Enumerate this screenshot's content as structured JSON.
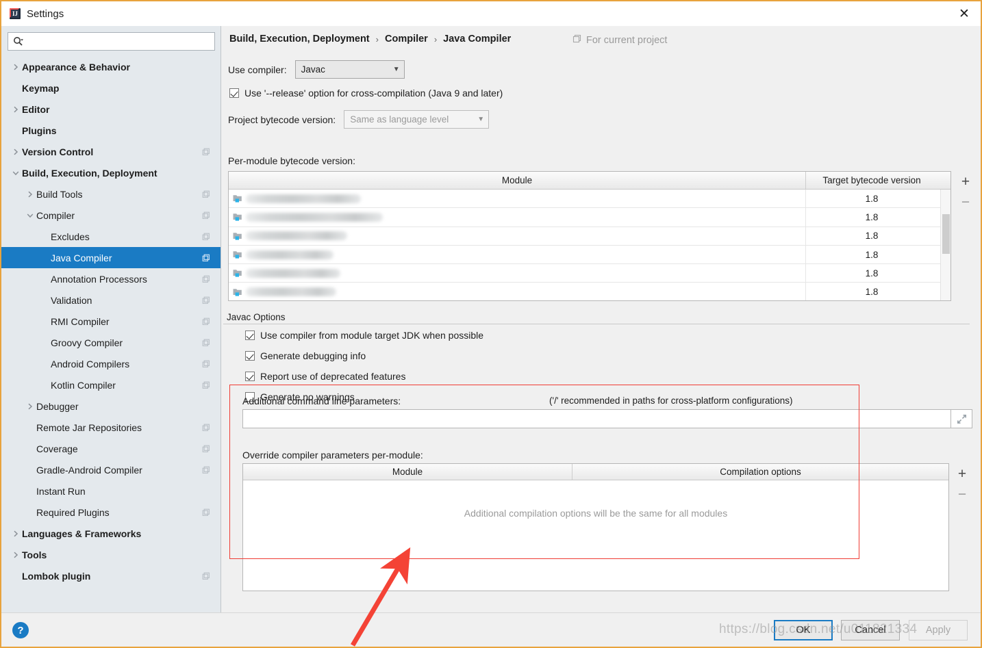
{
  "window": {
    "title": "Settings",
    "app_icon": "intellij-idea-icon",
    "close_label": "✕",
    "accent_color": "#1a7bc4",
    "border_color": "#e8a33d"
  },
  "sidebar": {
    "search": {
      "placeholder": "",
      "value": "",
      "icon": "search-icon"
    },
    "items": [
      {
        "label": "Appearance & Behavior",
        "indent": 0,
        "arrow": "right",
        "bold": true,
        "copy": false,
        "selected": false
      },
      {
        "label": "Keymap",
        "indent": 0,
        "arrow": "none",
        "bold": true,
        "copy": false,
        "selected": false
      },
      {
        "label": "Editor",
        "indent": 0,
        "arrow": "right",
        "bold": true,
        "copy": false,
        "selected": false
      },
      {
        "label": "Plugins",
        "indent": 0,
        "arrow": "none",
        "bold": true,
        "copy": false,
        "selected": false
      },
      {
        "label": "Version Control",
        "indent": 0,
        "arrow": "right",
        "bold": true,
        "copy": true,
        "selected": false
      },
      {
        "label": "Build, Execution, Deployment",
        "indent": 0,
        "arrow": "down",
        "bold": true,
        "copy": false,
        "selected": false
      },
      {
        "label": "Build Tools",
        "indent": 1,
        "arrow": "right",
        "bold": false,
        "copy": true,
        "selected": false
      },
      {
        "label": "Compiler",
        "indent": 1,
        "arrow": "down",
        "bold": false,
        "copy": true,
        "selected": false
      },
      {
        "label": "Excludes",
        "indent": 2,
        "arrow": "none",
        "bold": false,
        "copy": true,
        "selected": false
      },
      {
        "label": "Java Compiler",
        "indent": 2,
        "arrow": "none",
        "bold": false,
        "copy": true,
        "selected": true
      },
      {
        "label": "Annotation Processors",
        "indent": 2,
        "arrow": "none",
        "bold": false,
        "copy": true,
        "selected": false
      },
      {
        "label": "Validation",
        "indent": 2,
        "arrow": "none",
        "bold": false,
        "copy": true,
        "selected": false
      },
      {
        "label": "RMI Compiler",
        "indent": 2,
        "arrow": "none",
        "bold": false,
        "copy": true,
        "selected": false
      },
      {
        "label": "Groovy Compiler",
        "indent": 2,
        "arrow": "none",
        "bold": false,
        "copy": true,
        "selected": false
      },
      {
        "label": "Android Compilers",
        "indent": 2,
        "arrow": "none",
        "bold": false,
        "copy": true,
        "selected": false
      },
      {
        "label": "Kotlin Compiler",
        "indent": 2,
        "arrow": "none",
        "bold": false,
        "copy": true,
        "selected": false
      },
      {
        "label": "Debugger",
        "indent": 1,
        "arrow": "right",
        "bold": false,
        "copy": false,
        "selected": false
      },
      {
        "label": "Remote Jar Repositories",
        "indent": 1,
        "arrow": "none",
        "bold": false,
        "copy": true,
        "selected": false
      },
      {
        "label": "Coverage",
        "indent": 1,
        "arrow": "none",
        "bold": false,
        "copy": true,
        "selected": false
      },
      {
        "label": "Gradle-Android Compiler",
        "indent": 1,
        "arrow": "none",
        "bold": false,
        "copy": true,
        "selected": false
      },
      {
        "label": "Instant Run",
        "indent": 1,
        "arrow": "none",
        "bold": false,
        "copy": false,
        "selected": false
      },
      {
        "label": "Required Plugins",
        "indent": 1,
        "arrow": "none",
        "bold": false,
        "copy": true,
        "selected": false
      },
      {
        "label": "Languages & Frameworks",
        "indent": 0,
        "arrow": "right",
        "bold": true,
        "copy": false,
        "selected": false
      },
      {
        "label": "Tools",
        "indent": 0,
        "arrow": "right",
        "bold": true,
        "copy": false,
        "selected": false
      },
      {
        "label": "Lombok plugin",
        "indent": 0,
        "arrow": "none",
        "bold": true,
        "copy": true,
        "selected": false
      }
    ]
  },
  "main": {
    "breadcrumb": [
      "Build, Execution, Deployment",
      "Compiler",
      "Java Compiler"
    ],
    "breadcrumb_separator": "›",
    "scope_label": "For current project",
    "scope_icon": "copy-scope-icon",
    "use_compiler_label": "Use compiler:",
    "use_compiler_value": "Javac",
    "release_option_label": "Use '--release' option for cross-compilation (Java 9 and later)",
    "release_option_checked": true,
    "project_bytecode_label": "Project bytecode version:",
    "project_bytecode_value": "Same as language level",
    "per_module_label": "Per-module bytecode version:",
    "module_table": {
      "columns": [
        "Module",
        "Target bytecode version"
      ],
      "rows": [
        {
          "module": "",
          "module_redacted": true,
          "target": "1.8"
        },
        {
          "module": "",
          "module_redacted": true,
          "target": "1.8"
        },
        {
          "module": "",
          "module_redacted": true,
          "target": "1.8"
        },
        {
          "module": "",
          "module_redacted": true,
          "target": "1.8"
        },
        {
          "module": "",
          "module_redacted": true,
          "target": "1.8"
        },
        {
          "module": "",
          "module_redacted": true,
          "target": "1.8"
        }
      ],
      "add_label": "+",
      "remove_label": "−"
    },
    "javac_group_title": "Javac Options",
    "javac_options": [
      {
        "label": "Use compiler from module target JDK when possible",
        "checked": true
      },
      {
        "label": "Generate debugging info",
        "checked": true
      },
      {
        "label": "Report use of deprecated features",
        "checked": true
      },
      {
        "label": "Generate no warnings",
        "checked": false
      }
    ],
    "additional_params_label": "Additional command line parameters:",
    "additional_params_hint": "('/' recommended in paths for cross-platform configurations)",
    "additional_params_value": "",
    "expand_icon": "expand-arrows-icon",
    "override_label": "Override compiler parameters per-module:",
    "override_table": {
      "columns": [
        "Module",
        "Compilation options"
      ],
      "rows": [],
      "empty_message": "Additional compilation options will be the same for all modules",
      "add_label": "+",
      "remove_label": "−"
    }
  },
  "footer": {
    "help_label": "?",
    "ok_label": "OK",
    "cancel_label": "Cancel",
    "apply_label": "Apply"
  },
  "annotation": {
    "arrow_color": "#f44336",
    "highlight_color": "#ef3b33",
    "watermark": "https://blog.csdn.net/u011821334"
  }
}
